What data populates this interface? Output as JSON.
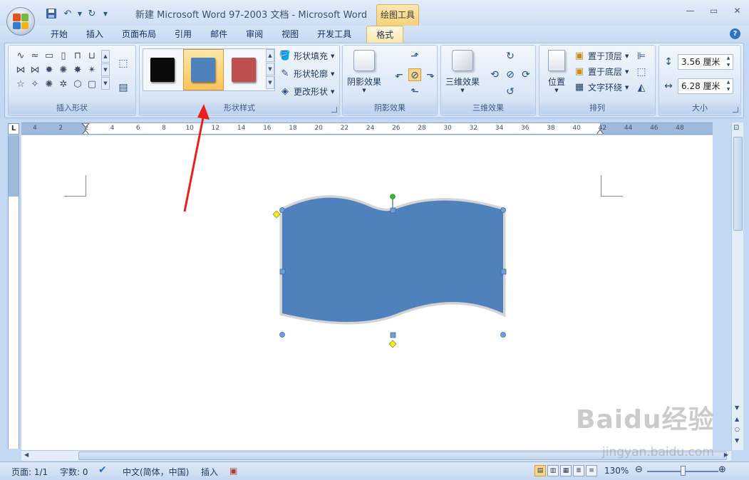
{
  "app": {
    "title": "新建 Microsoft Word 97-2003 文档 - Microsoft Word",
    "context_tab_title": "绘图工具"
  },
  "window_controls": {
    "minimize": "—",
    "maximize": "▭",
    "close": "✕"
  },
  "qat": {
    "save_icon": "save-icon",
    "undo_icon": "undo-icon",
    "redo_icon": "redo-icon"
  },
  "tabs": [
    {
      "label": "开始"
    },
    {
      "label": "插入"
    },
    {
      "label": "页面布局"
    },
    {
      "label": "引用"
    },
    {
      "label": "邮件"
    },
    {
      "label": "审阅"
    },
    {
      "label": "视图"
    },
    {
      "label": "开发工具"
    },
    {
      "label": "格式",
      "active": true
    }
  ],
  "ribbon": {
    "insert_shapes": {
      "label": "插入形状"
    },
    "shape_styles": {
      "label": "形状样式",
      "swatches": [
        {
          "color": "#0a0a0a"
        },
        {
          "color": "#4f81bd",
          "selected": true
        },
        {
          "color": "#c0504d"
        }
      ],
      "fill": "形状填充",
      "outline": "形状轮廓",
      "change": "更改形状"
    },
    "shadow": {
      "button": "阴影效果",
      "label": "阴影效果"
    },
    "threed": {
      "button": "三维效果",
      "label": "三维效果"
    },
    "arrange": {
      "label": "排列",
      "position": "位置",
      "bring_front": "置于顶层",
      "send_back": "置于底层",
      "wrap_text": "文字环绕"
    },
    "size": {
      "label": "大小",
      "height": "3.56 厘米",
      "width": "6.28 厘米"
    }
  },
  "ruler": {
    "corner": "L",
    "ticks": [
      "4",
      "2",
      "2",
      "4",
      "6",
      "8",
      "10",
      "12",
      "14",
      "16",
      "18",
      "20",
      "22",
      "24",
      "26",
      "28",
      "30",
      "32",
      "34",
      "36",
      "38",
      "40",
      "42",
      "44",
      "46",
      "48"
    ]
  },
  "shape": {
    "fill": "#4f81bd",
    "outline": "#d4d4d4"
  },
  "statusbar": {
    "page": "页面: 1/1",
    "words": "字数: 0",
    "language": "中文(简体，中国)",
    "mode": "插入",
    "zoom": "130%"
  },
  "watermark": {
    "main": "Baidu经验",
    "sub": "jingyan.baidu.com"
  }
}
